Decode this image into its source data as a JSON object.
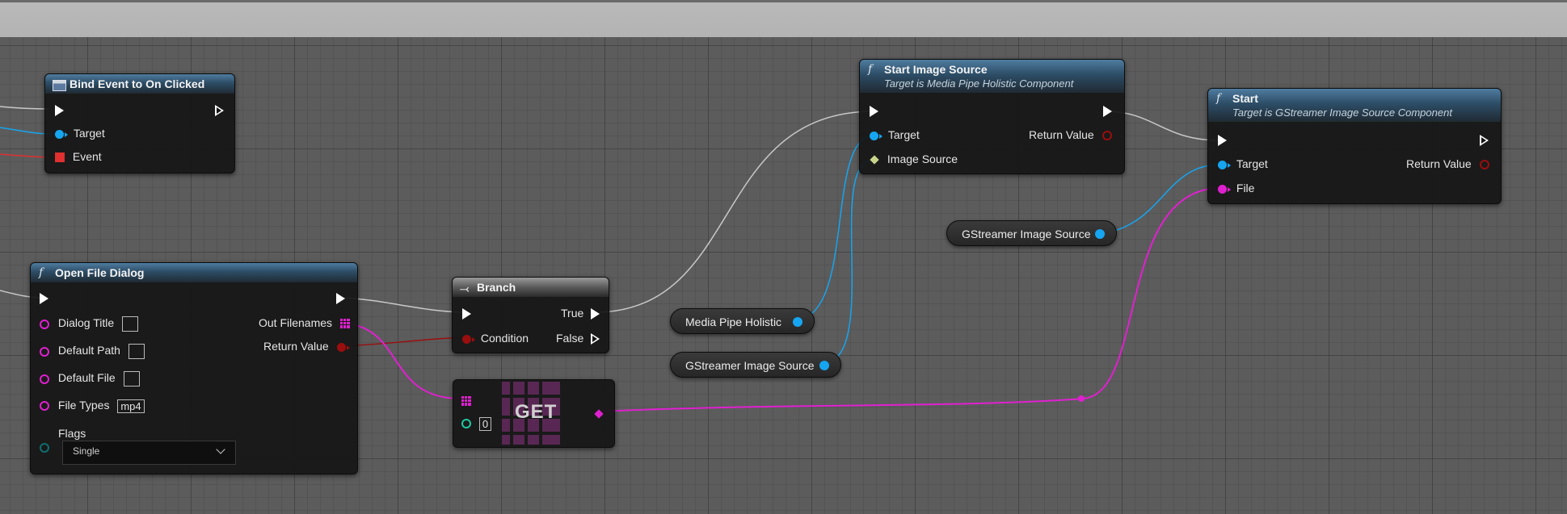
{
  "nodes": {
    "bind_event": {
      "title": "Bind Event to On Clicked",
      "target": "Target",
      "event": "Event"
    },
    "start_image_source": {
      "title": "Start Image Source",
      "subtitle": "Target is Media Pipe Holistic Component",
      "target": "Target",
      "image_source": "Image Source",
      "return_value": "Return Value"
    },
    "start": {
      "title": "Start",
      "subtitle": "Target is GStreamer Image Source Component",
      "target": "Target",
      "file": "File",
      "return_value": "Return Value"
    },
    "open_file_dialog": {
      "title": "Open File Dialog",
      "dialog_title": "Dialog Title",
      "default_path": "Default Path",
      "default_file": "Default File",
      "file_types": "File Types",
      "file_types_value": "mp4",
      "flags": "Flags",
      "flags_value": "Single",
      "out_filenames": "Out Filenames",
      "return_value": "Return Value"
    },
    "branch": {
      "title": "Branch",
      "true_label": "True",
      "false_label": "False",
      "condition": "Condition"
    },
    "get": {
      "label": "GET",
      "index": "0"
    }
  },
  "variables": {
    "gstreamer_top": "GStreamer Image Source",
    "media_pipe": "Media Pipe Holistic",
    "gstreamer_bottom": "GStreamer Image Source"
  },
  "colors": {
    "exec_wire": "#c8c8c8",
    "object_pin": "#16a5f0",
    "string_pin": "#e020d0",
    "bool_pin": "#9a0e0e",
    "event_pin": "#e03030",
    "struct_pin": "#c8d48a",
    "int_pin": "#20c8a0",
    "enum_pin": "#0f6e6e"
  }
}
